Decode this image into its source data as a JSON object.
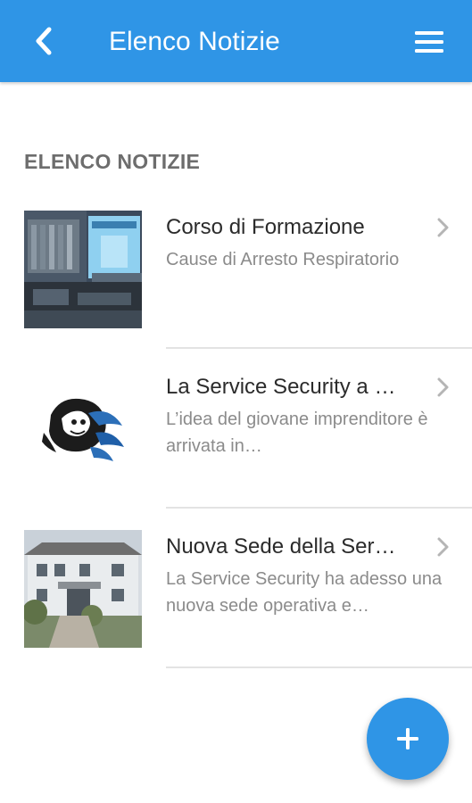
{
  "header": {
    "title": "Elenco Notizie",
    "back_icon": "chevron-left-icon",
    "menu_icon": "hamburger-menu-icon",
    "background": "#2f95e6"
  },
  "section": {
    "title": "ELENCO NOTIZIE"
  },
  "news": [
    {
      "title": "Corso di Formazione",
      "subtitle": "Cause di Arresto Respiratorio",
      "thumbnail": "classroom-projector-photo"
    },
    {
      "title": "La Service Security a …",
      "subtitle": "L’idea del giovane imprenditore è arrivata in…",
      "thumbnail": "lion-logo"
    },
    {
      "title": "Nuova Sede della Ser…",
      "subtitle": "La Service Security ha adesso una nuova sede operativa e…",
      "thumbnail": "building-photo"
    }
  ],
  "fab": {
    "icon": "plus-icon"
  },
  "colors": {
    "accent": "#2f95e6",
    "title_text": "#2b2b2b",
    "subtitle_text": "#8b8b8b",
    "section_text": "#6d6d6d"
  }
}
